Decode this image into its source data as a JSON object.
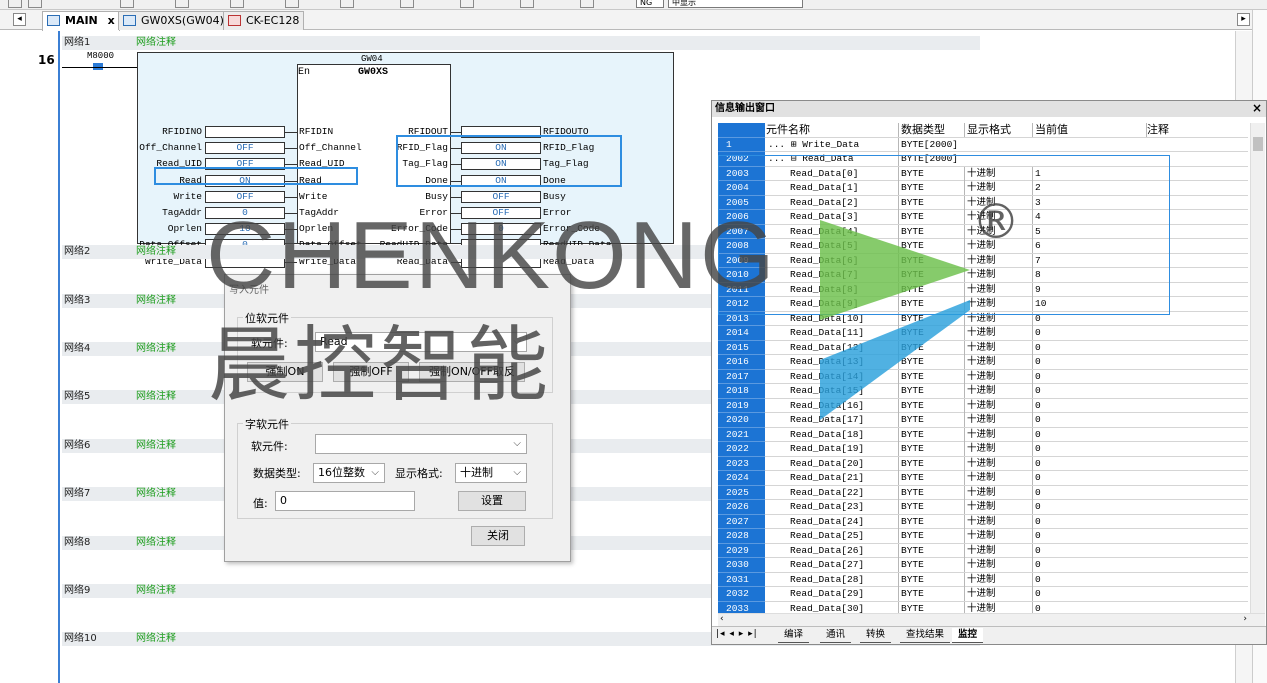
{
  "tabs": {
    "main": "MAIN",
    "main_close": "x",
    "gw": "GW0XS(GW04)",
    "ck": "CK-EC128"
  },
  "toolbar": {
    "combo1": "NG",
    "combo2": "中显示"
  },
  "ladder": {
    "network_number": "16",
    "contact_label": "M8000",
    "networks": [
      {
        "name": "网络1",
        "comment": "网络注释"
      },
      {
        "name": "网络2",
        "comment": "网络注释"
      },
      {
        "name": "网络3",
        "comment": "网络注释"
      },
      {
        "name": "网络4",
        "comment": "网络注释"
      },
      {
        "name": "网络5",
        "comment": "网络注释"
      },
      {
        "name": "网络6",
        "comment": "网络注释"
      },
      {
        "name": "网络7",
        "comment": "网络注释"
      },
      {
        "name": "网络8",
        "comment": "网络注释"
      },
      {
        "name": "网络9",
        "comment": "网络注释"
      },
      {
        "name": "网络10",
        "comment": "网络注释"
      }
    ],
    "block": {
      "instance": "GW04",
      "type": "GW0XS",
      "en": "En",
      "inputs": [
        {
          "ext": "RFIDINO",
          "val": "",
          "pin": "RFIDIN"
        },
        {
          "ext": "Off_Channel",
          "val": "OFF",
          "pin": "Off_Channel"
        },
        {
          "ext": "Read_UID",
          "val": "OFF",
          "pin": "Read_UID"
        },
        {
          "ext": "Read",
          "val": "ON",
          "pin": "Read"
        },
        {
          "ext": "Write",
          "val": "OFF",
          "pin": "Write"
        },
        {
          "ext": "TagAddr",
          "val": "0",
          "pin": "TagAddr"
        },
        {
          "ext": "Oprlen",
          "val": "10",
          "pin": "Oprlen"
        },
        {
          "ext": "Data_Offset",
          "val": "0",
          "pin": "Data_Offset"
        },
        {
          "ext": "Write_Data",
          "val": "",
          "pin": "Write_Data"
        }
      ],
      "outputs": [
        {
          "pin": "RFIDOUT",
          "val": "",
          "ext": "RFIDOUTO"
        },
        {
          "pin": "RFID_Flag",
          "val": "ON",
          "ext": "RFID_Flag"
        },
        {
          "pin": "Tag_Flag",
          "val": "ON",
          "ext": "Tag_Flag"
        },
        {
          "pin": "Done",
          "val": "ON",
          "ext": "Done"
        },
        {
          "pin": "Busy",
          "val": "OFF",
          "ext": "Busy"
        },
        {
          "pin": "Error",
          "val": "OFF",
          "ext": "Error"
        },
        {
          "pin": "Error_Code",
          "val": "0",
          "ext": "Error_Code"
        },
        {
          "pin": "ReadUID_Data",
          "val": "",
          "ext": "ReadUID_Data"
        },
        {
          "pin": "Read_Data",
          "val": "",
          "ext": "Read_Data"
        }
      ]
    }
  },
  "dialog": {
    "title": "写入元件",
    "bit_group": "位软元件",
    "bit_label": "软元件:",
    "bit_value": "Read",
    "force_on": "强制ON",
    "force_off": "强制OFF",
    "force_toggle": "强制ON/OFF取反",
    "word_group": "字软元件",
    "word_label": "软元件:",
    "word_value": "",
    "dtype_label": "数据类型:",
    "dtype_value": "16位整数",
    "fmt_label": "显示格式:",
    "fmt_value": "十进制",
    "val_label": "值:",
    "val_value": "0",
    "set_button": "设置",
    "close_button": "关闭"
  },
  "watermark": {
    "en": "CHENKONG",
    "cn": "晨控智能",
    "reg": "®"
  },
  "info": {
    "title": "信息输出窗口",
    "close": "×",
    "headers": [
      "元件名称",
      "数据类型",
      "显示格式",
      "当前值",
      "注释"
    ],
    "rows": [
      {
        "n": "1",
        "name": "Write_Data",
        "prefix": "... ⊞ ",
        "type": "BYTE[2000]",
        "fmt": "",
        "val": ""
      },
      {
        "n": "2002",
        "name": "Read_Data",
        "prefix": "... ⊟ ",
        "type": "BYTE[2000]",
        "fmt": "",
        "val": ""
      },
      {
        "n": "2003",
        "name": "Read_Data[0]",
        "prefix": "",
        "type": "BYTE",
        "fmt": "十进制",
        "val": "1"
      },
      {
        "n": "2004",
        "name": "Read_Data[1]",
        "prefix": "",
        "type": "BYTE",
        "fmt": "十进制",
        "val": "2"
      },
      {
        "n": "2005",
        "name": "Read_Data[2]",
        "prefix": "",
        "type": "BYTE",
        "fmt": "十进制",
        "val": "3"
      },
      {
        "n": "2006",
        "name": "Read_Data[3]",
        "prefix": "",
        "type": "BYTE",
        "fmt": "十进制",
        "val": "4"
      },
      {
        "n": "2007",
        "name": "Read_Data[4]",
        "prefix": "",
        "type": "BYTE",
        "fmt": "十进制",
        "val": "5"
      },
      {
        "n": "2008",
        "name": "Read_Data[5]",
        "prefix": "",
        "type": "BYTE",
        "fmt": "十进制",
        "val": "6"
      },
      {
        "n": "2009",
        "name": "Read_Data[6]",
        "prefix": "",
        "type": "BYTE",
        "fmt": "十进制",
        "val": "7"
      },
      {
        "n": "2010",
        "name": "Read_Data[7]",
        "prefix": "",
        "type": "BYTE",
        "fmt": "十进制",
        "val": "8"
      },
      {
        "n": "2011",
        "name": "Read_Data[8]",
        "prefix": "",
        "type": "BYTE",
        "fmt": "十进制",
        "val": "9"
      },
      {
        "n": "2012",
        "name": "Read_Data[9]",
        "prefix": "",
        "type": "BYTE",
        "fmt": "十进制",
        "val": "10"
      },
      {
        "n": "2013",
        "name": "Read_Data[10]",
        "prefix": "",
        "type": "BYTE",
        "fmt": "十进制",
        "val": "0"
      },
      {
        "n": "2014",
        "name": "Read_Data[11]",
        "prefix": "",
        "type": "BYTE",
        "fmt": "十进制",
        "val": "0"
      },
      {
        "n": "2015",
        "name": "Read_Data[12]",
        "prefix": "",
        "type": "BYTE",
        "fmt": "十进制",
        "val": "0"
      },
      {
        "n": "2016",
        "name": "Read_Data[13]",
        "prefix": "",
        "type": "BYTE",
        "fmt": "十进制",
        "val": "0"
      },
      {
        "n": "2017",
        "name": "Read_Data[14]",
        "prefix": "",
        "type": "BYTE",
        "fmt": "十进制",
        "val": "0"
      },
      {
        "n": "2018",
        "name": "Read_Data[15]",
        "prefix": "",
        "type": "BYTE",
        "fmt": "十进制",
        "val": "0"
      },
      {
        "n": "2019",
        "name": "Read_Data[16]",
        "prefix": "",
        "type": "BYTE",
        "fmt": "十进制",
        "val": "0"
      },
      {
        "n": "2020",
        "name": "Read_Data[17]",
        "prefix": "",
        "type": "BYTE",
        "fmt": "十进制",
        "val": "0"
      },
      {
        "n": "2021",
        "name": "Read_Data[18]",
        "prefix": "",
        "type": "BYTE",
        "fmt": "十进制",
        "val": "0"
      },
      {
        "n": "2022",
        "name": "Read_Data[19]",
        "prefix": "",
        "type": "BYTE",
        "fmt": "十进制",
        "val": "0"
      },
      {
        "n": "2023",
        "name": "Read_Data[20]",
        "prefix": "",
        "type": "BYTE",
        "fmt": "十进制",
        "val": "0"
      },
      {
        "n": "2024",
        "name": "Read_Data[21]",
        "prefix": "",
        "type": "BYTE",
        "fmt": "十进制",
        "val": "0"
      },
      {
        "n": "2025",
        "name": "Read_Data[22]",
        "prefix": "",
        "type": "BYTE",
        "fmt": "十进制",
        "val": "0"
      },
      {
        "n": "2026",
        "name": "Read_Data[23]",
        "prefix": "",
        "type": "BYTE",
        "fmt": "十进制",
        "val": "0"
      },
      {
        "n": "2027",
        "name": "Read_Data[24]",
        "prefix": "",
        "type": "BYTE",
        "fmt": "十进制",
        "val": "0"
      },
      {
        "n": "2028",
        "name": "Read_Data[25]",
        "prefix": "",
        "type": "BYTE",
        "fmt": "十进制",
        "val": "0"
      },
      {
        "n": "2029",
        "name": "Read_Data[26]",
        "prefix": "",
        "type": "BYTE",
        "fmt": "十进制",
        "val": "0"
      },
      {
        "n": "2030",
        "name": "Read_Data[27]",
        "prefix": "",
        "type": "BYTE",
        "fmt": "十进制",
        "val": "0"
      },
      {
        "n": "2031",
        "name": "Read_Data[28]",
        "prefix": "",
        "type": "BYTE",
        "fmt": "十进制",
        "val": "0"
      },
      {
        "n": "2032",
        "name": "Read_Data[29]",
        "prefix": "",
        "type": "BYTE",
        "fmt": "十进制",
        "val": "0"
      },
      {
        "n": "2033",
        "name": "Read_Data[30]",
        "prefix": "",
        "type": "BYTE",
        "fmt": "十进制",
        "val": "0"
      }
    ],
    "sheet_tabs": [
      "编译",
      "通讯",
      "转换",
      "查找结果",
      "监控"
    ]
  },
  "colors": {
    "accent": "#1c74d4",
    "highlight": "#2e8de0",
    "comment": "#1e9e1e",
    "logo_green": "#6bbf4a",
    "logo_blue": "#2aa0dc"
  }
}
